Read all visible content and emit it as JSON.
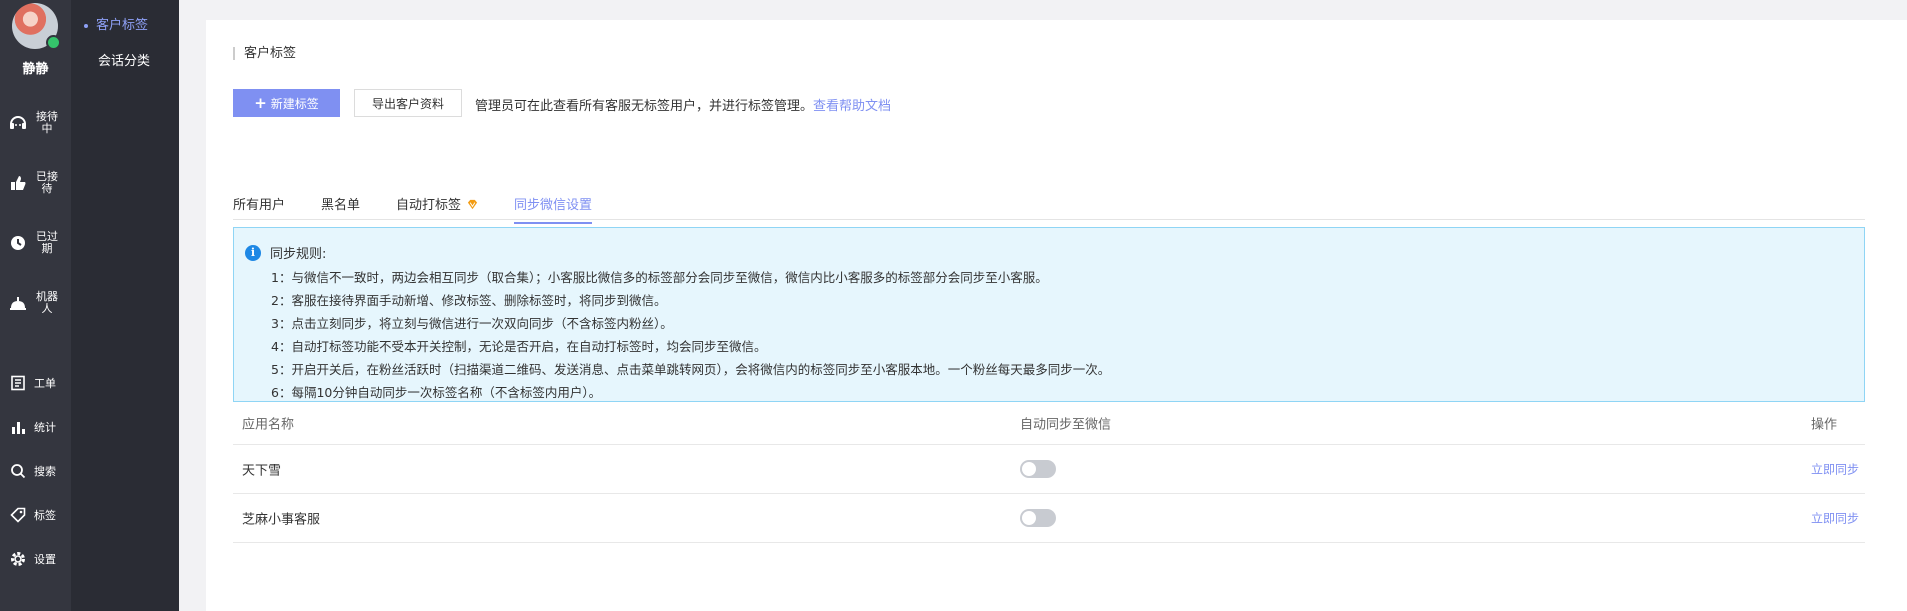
{
  "user": {
    "name": "静静"
  },
  "rail": {
    "items": [
      {
        "label": "接待中",
        "icon": "headset-icon"
      },
      {
        "label": "已接待",
        "icon": "thumbs-up-icon"
      },
      {
        "label": "已过期",
        "icon": "expired-clock-icon"
      },
      {
        "label": "机器人",
        "icon": "robot-icon"
      },
      {
        "label": "工单",
        "icon": "ticket-icon"
      },
      {
        "label": "统计",
        "icon": "bar-chart-icon"
      },
      {
        "label": "搜索",
        "icon": "search-icon"
      },
      {
        "label": "标签",
        "icon": "tag-icon"
      },
      {
        "label": "设置",
        "icon": "gear-icon"
      }
    ]
  },
  "subnav": {
    "items": [
      {
        "label": "客户标签",
        "active": true
      },
      {
        "label": "会话分类",
        "active": false
      }
    ]
  },
  "page": {
    "title": "客户标签",
    "new_tag_label": "新建标签",
    "export_label": "导出客户资料",
    "tip_text": "管理员可在此查看所有客服无标签用户，并进行标签管理。",
    "help_link": "查看帮助文档"
  },
  "tabs": [
    {
      "label": "所有用户",
      "active": false
    },
    {
      "label": "黑名单",
      "active": false
    },
    {
      "label": "自动打标签",
      "active": false,
      "badge_icon": "vip-diamond-icon"
    },
    {
      "label": "同步微信设置",
      "active": true
    }
  ],
  "notice": {
    "title": "同步规则:",
    "lines": [
      "1：与微信不一致时，两边会相互同步（取合集）；小客服比微信多的标签部分会同步至微信，微信内比小客服多的标签部分会同步至小客服。",
      "2：客服在接待界面手动新增、修改标签、删除标签时，将同步到微信。",
      "3：点击立刻同步，将立刻与微信进行一次双向同步（不含标签内粉丝）。",
      "4：自动打标签功能不受本开关控制，无论是否开启，在自动打标签时，均会同步至微信。",
      "5：开启开关后，在粉丝活跃时（扫描渠道二维码、发送消息、点击菜单跳转网页），会将微信内的标签同步至小客服本地。一个粉丝每天最多同步一次。",
      "6：每隔10分钟自动同步一次标签名称（不含标签内用户）。"
    ]
  },
  "table": {
    "columns": [
      "应用名称",
      "自动同步至微信",
      "操作"
    ],
    "rows": [
      {
        "name": "天下雪",
        "auto_sync": false,
        "action": "立即同步"
      },
      {
        "name": "芝麻小事客服",
        "auto_sync": false,
        "action": "立即同步"
      }
    ]
  },
  "colors": {
    "accent": "#7f90f2",
    "rail_bg": "#34363f",
    "subnav_bg": "#2a2c34",
    "notice_bg": "#e6f6fd",
    "notice_border": "#8fd5f5"
  }
}
